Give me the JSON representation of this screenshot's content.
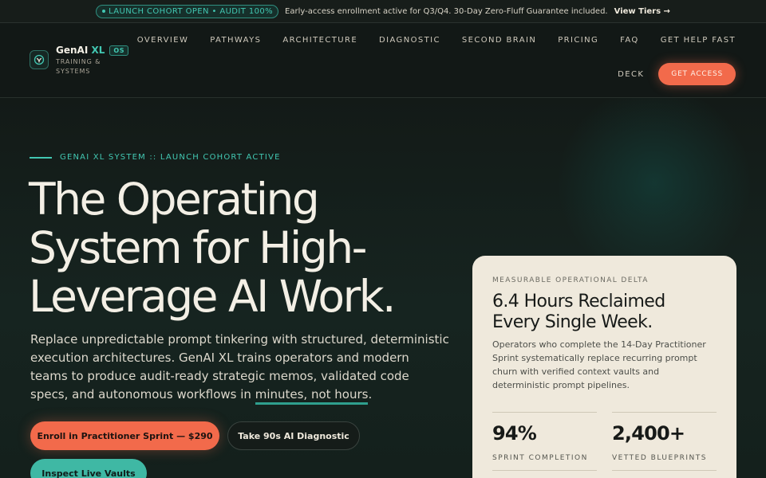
{
  "announcement": {
    "badge": "LAUNCH COHORT OPEN • AUDIT 100%",
    "message": "Early-access enrollment active for Q3/Q4. 30-Day Zero-Fluff Guarantee included.",
    "link": "View Tiers →"
  },
  "logo": {
    "brand": "GenAI",
    "brand_accent": "XL",
    "tag": "OS",
    "subtitle": "TRAINING & SYSTEMS"
  },
  "nav": {
    "items": [
      "OVERVIEW",
      "PATHWAYS",
      "ARCHITECTURE",
      "DIAGNOSTIC",
      "SECOND BRAIN",
      "PRICING",
      "FAQ",
      "GET HELP FAST"
    ],
    "deck": "DECK",
    "cta": "GET ACCESS"
  },
  "hero": {
    "eyebrow": "GENAI XL SYSTEM :: LAUNCH COHORT ACTIVE",
    "title": "The Operating System for High-Leverage AI Work.",
    "description": "Replace unpredictable prompt tinkering with structured, deterministic execution architectures. GenAI XL trains operators and modern teams to produce audit-ready strategic memos, validated code specs, and autonomous workflows in ",
    "highlight": "minutes, not hours",
    "period": ".",
    "buttons": {
      "enroll": "Enroll in Practitioner Sprint — $290",
      "diagnostic": "Take 90s AI Diagnostic",
      "vaults": "Inspect Live Vaults"
    }
  },
  "card": {
    "eyebrow": "MEASURABLE OPERATIONAL DELTA",
    "title": "6.4 Hours Reclaimed Every Single Week.",
    "description": "Operators who complete the 14-Day Practitioner Sprint systematically replace recurring prompt churn with verified context vaults and deterministic prompt pipelines.",
    "stats": [
      {
        "value": "94%",
        "label": "SPRINT COMPLETION"
      },
      {
        "value": "2,400+",
        "label": "VETTED BLUEPRINTS"
      }
    ]
  },
  "colors": {
    "accent_teal": "#42c7b2",
    "accent_coral": "#f26a4b",
    "background": "#141b18",
    "card": "#efe9dc"
  }
}
